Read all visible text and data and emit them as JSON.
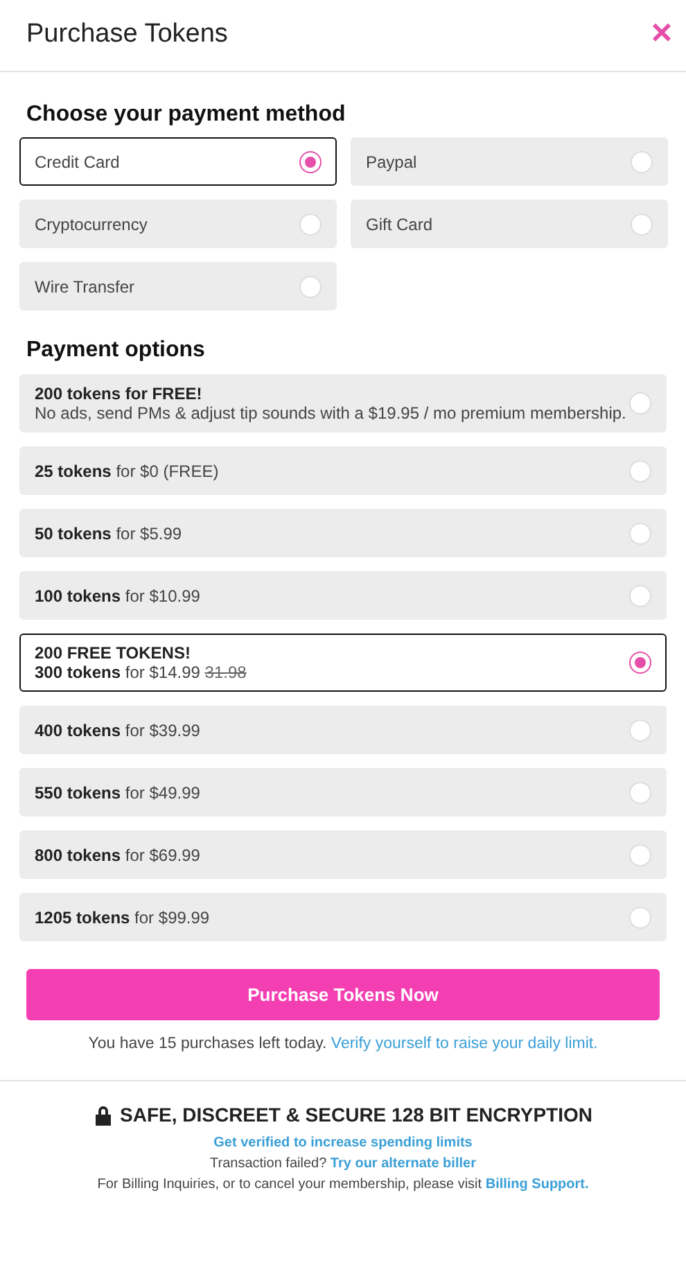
{
  "title": "Purchase Tokens",
  "close": "×",
  "method_heading": "Choose your payment method",
  "methods": [
    {
      "label": "Credit Card",
      "selected": true
    },
    {
      "label": "Paypal",
      "selected": false
    },
    {
      "label": "Cryptocurrency",
      "selected": false
    },
    {
      "label": "Gift Card",
      "selected": false
    },
    {
      "label": "Wire Transfer",
      "selected": false
    }
  ],
  "options_heading": "Payment options",
  "options": [
    {
      "title": "200 tokens for FREE!",
      "text": "No ads, send PMs & adjust tip sounds with a $19.95 / mo premium membership.",
      "selected": false
    },
    {
      "text": "**25 tokens** for $0 (FREE)",
      "selected": false
    },
    {
      "text": "**50 tokens** for $5.99",
      "selected": false
    },
    {
      "text": "**100 tokens** for $10.99",
      "selected": false
    },
    {
      "title": "200 FREE TOKENS!",
      "text": "**300 tokens** for $14.99",
      "old_price": "31.98",
      "selected": true
    },
    {
      "text": "**400 tokens** for $39.99",
      "selected": false
    },
    {
      "text": "**550 tokens** for $49.99",
      "selected": false
    },
    {
      "text": "**800 tokens** for $69.99",
      "selected": false
    },
    {
      "text": "**1205 tokens** for $99.99",
      "selected": false
    }
  ],
  "purchase_button": "Purchase Tokens Now",
  "limit_note": {
    "text": "You have 15 purchases left today.",
    "link": "Verify yourself to raise your daily limit."
  },
  "security": "SAFE, DISCREET & SECURE 128 BIT ENCRYPTION",
  "verify_link": "Get verified to increase spending limits",
  "alternate": {
    "text": "Transaction failed?",
    "link": "Try our alternate biller"
  },
  "billing": {
    "text": "For Billing Inquiries, or to cancel your membership, please visit",
    "link": "Billing Support."
  }
}
